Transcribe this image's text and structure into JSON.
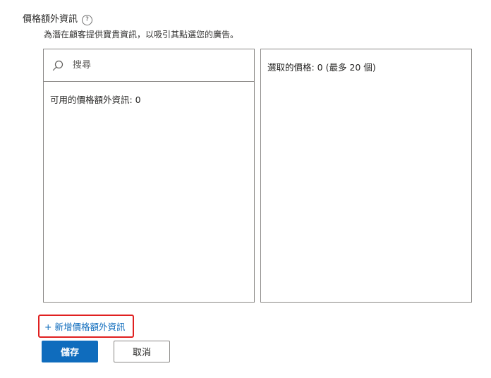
{
  "section": {
    "title": "價格額外資訊",
    "help_glyph": "?",
    "description": "為潛在顧客提供寶貴資訊，以吸引其點選您的廣告。"
  },
  "available_panel": {
    "search_placeholder": "搜尋",
    "available_text": "可用的價格額外資訊: 0"
  },
  "selected_panel": {
    "selected_text": "選取的價格: 0 (最多 20 個)"
  },
  "actions": {
    "add_link_label": "+ 新增價格額外資訊",
    "save_label": "儲存",
    "cancel_label": "取消"
  },
  "colors": {
    "accent": "#0f6cbd",
    "highlight": "#e02020",
    "border": "#8a8886"
  }
}
